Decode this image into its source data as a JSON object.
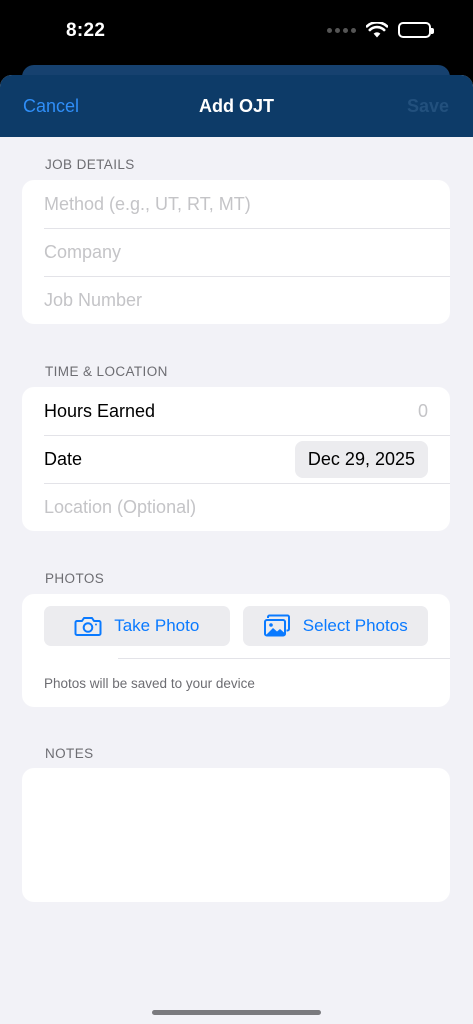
{
  "status": {
    "time": "8:22"
  },
  "nav": {
    "cancel": "Cancel",
    "title": "Add OJT",
    "save": "Save"
  },
  "job_details": {
    "header": "JOB DETAILS",
    "method_placeholder": "Method (e.g., UT, RT, MT)",
    "company_placeholder": "Company",
    "job_number_placeholder": "Job Number"
  },
  "time_location": {
    "header": "TIME & LOCATION",
    "hours_label": "Hours Earned",
    "hours_value": "0",
    "date_label": "Date",
    "date_value": "Dec 29, 2025",
    "location_placeholder": "Location (Optional)"
  },
  "photos": {
    "header": "PHOTOS",
    "take_photo": "Take Photo",
    "select_photos": "Select Photos",
    "note": "Photos will be saved to your device"
  },
  "notes": {
    "header": "NOTES",
    "value": ""
  },
  "colors": {
    "accent": "#0a7aff",
    "nav_background": "#0d3b68",
    "background": "#f2f2f7"
  }
}
